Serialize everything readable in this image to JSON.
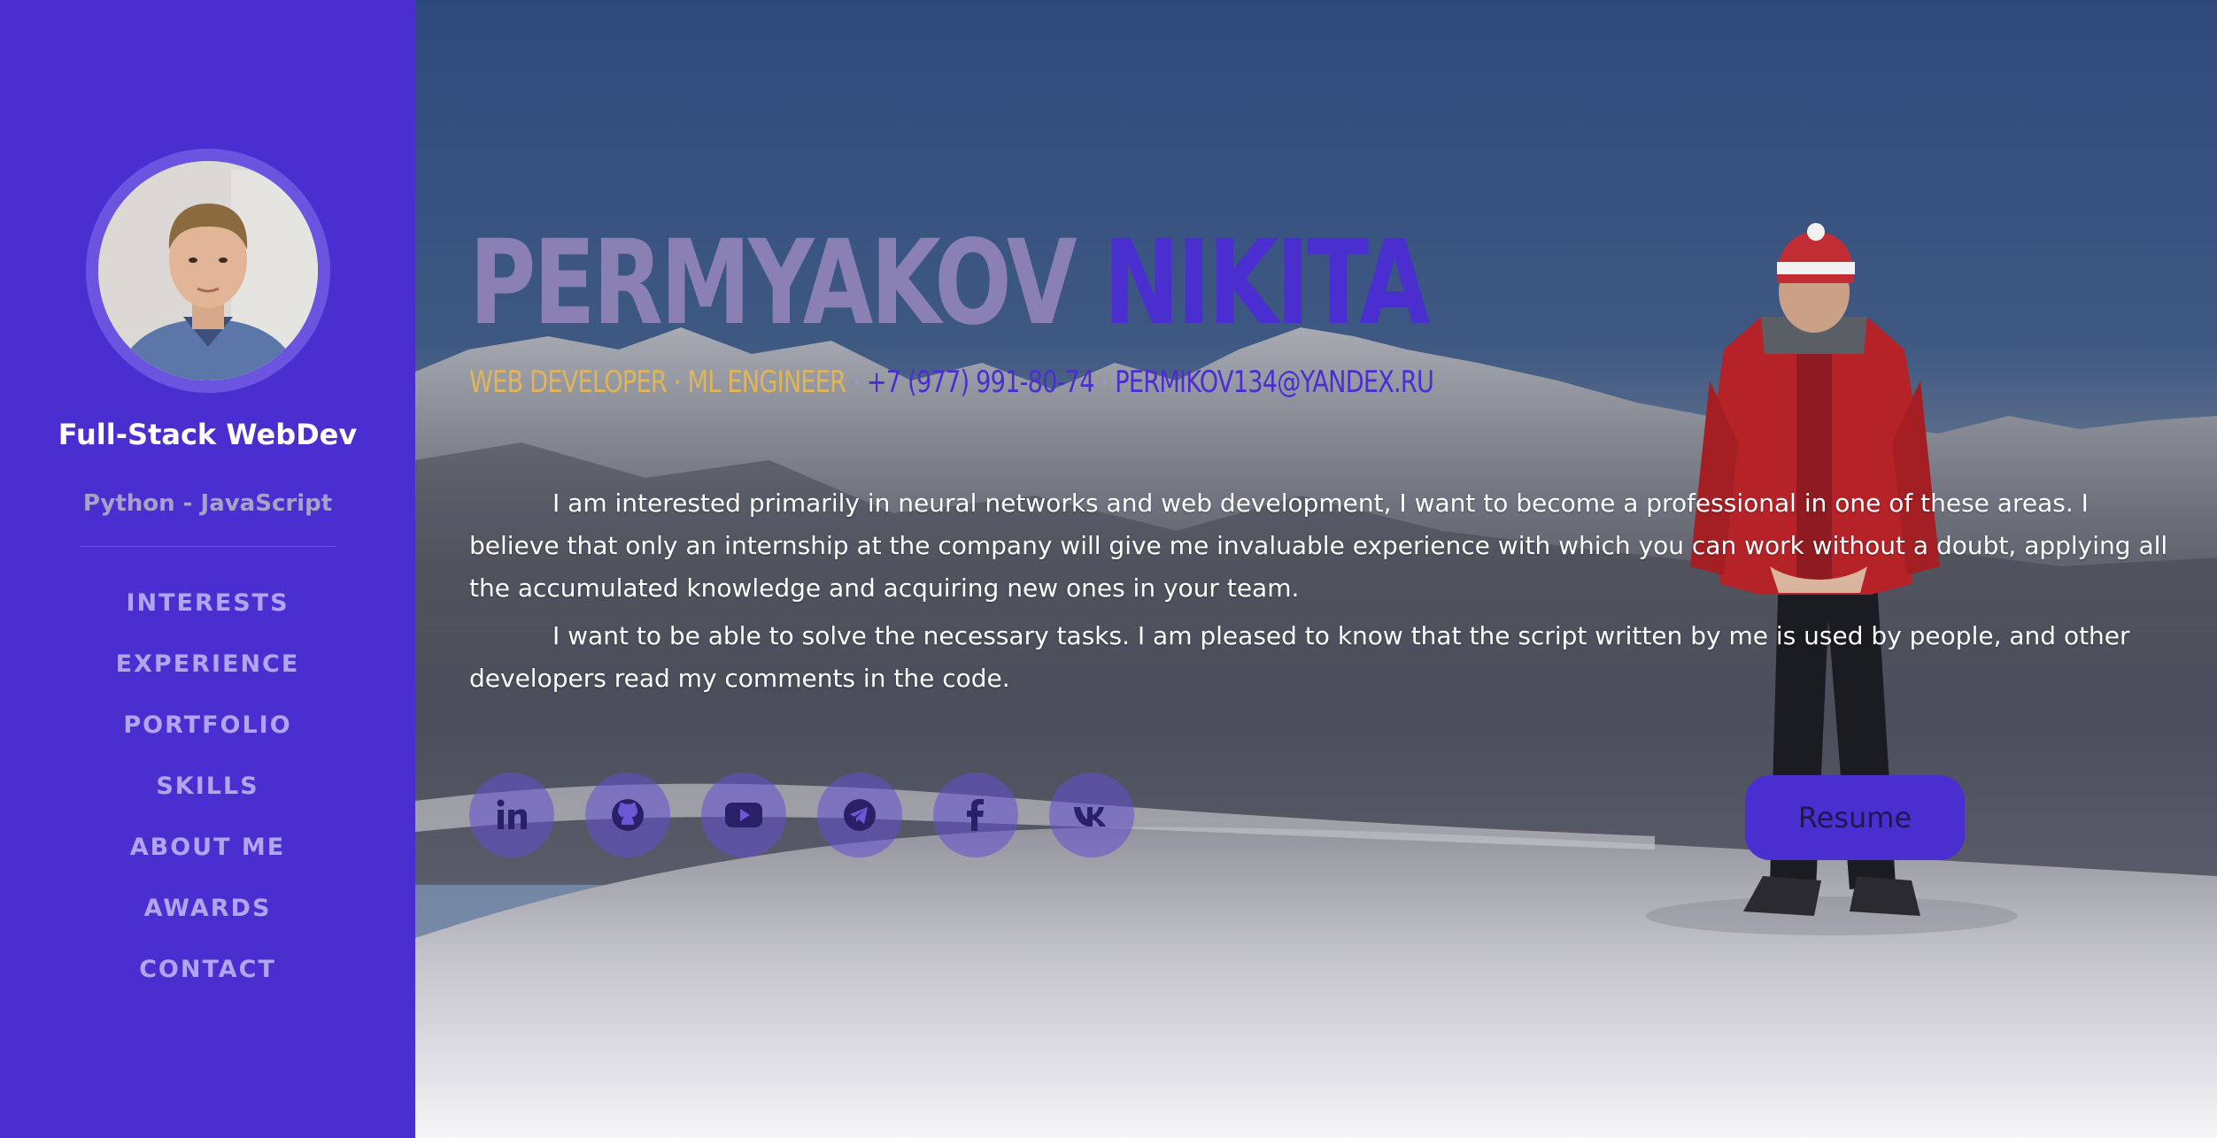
{
  "sidebar": {
    "role": "Full-Stack WebDev",
    "stack": "Python - JavaScript",
    "nav": [
      "INTERESTS",
      "EXPERIENCE",
      "PORTFOLIO",
      "SKILLS",
      "ABOUT ME",
      "AWARDS",
      "CONTACT"
    ]
  },
  "hero": {
    "name_first": "PERMYAKOV",
    "name_last": "NIKITA",
    "title": "WEB DEVELOPER · ML ENGINEER",
    "separator": " · ",
    "phone": "+7 (977) 991-80-74",
    "email": "PERMIKOV134@YANDEX.RU",
    "bio": [
      "I am interested primarily in neural networks and web development, I want to become a professional in one of these areas. I believe that only an internship at the company will give me invaluable experience with which you can work without a doubt, applying all the accumulated knowledge and acquiring new ones in your team.",
      "I want to be able to solve the necessary tasks. I am pleased to know that the script written by me is used by people, and other developers read my comments in the code."
    ],
    "socials": [
      "linkedin-icon",
      "github-icon",
      "youtube-icon",
      "telegram-icon",
      "facebook-icon",
      "vk-icon"
    ],
    "resume_label": "Resume"
  },
  "colors": {
    "accent": "#4b2ed0",
    "sidebar_muted": "#b1a5ee",
    "title_gold": "#e0b55a"
  }
}
